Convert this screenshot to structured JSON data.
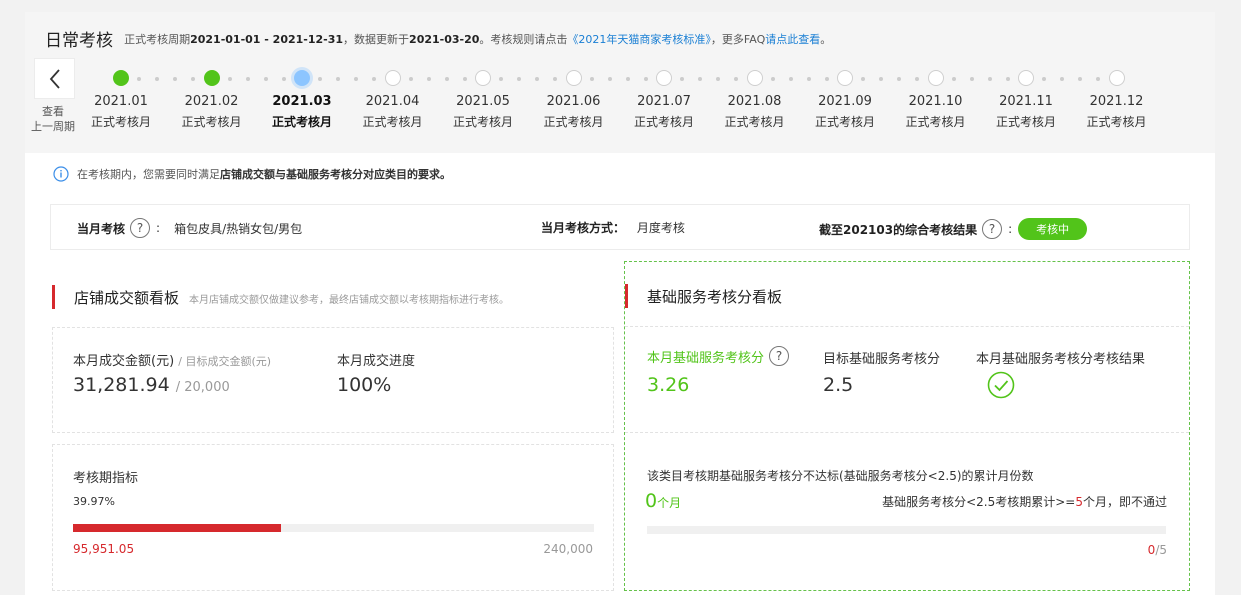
{
  "header": {
    "title": "日常考核",
    "info_pre": "正式考核周期",
    "period": "2021-01-01 - 2021-12-31",
    "info_mid1": "，数据更新于",
    "updated": "2021-03-20",
    "info_mid2": "。考核规则请点击",
    "rule_link": "《2021年天猫商家考核标准》",
    "info_mid3": "，更多FAQ",
    "faq_link": "请点此查看",
    "info_end": "。"
  },
  "back_button": {
    "label_line1": "查看",
    "label_line2": "上一周期"
  },
  "timeline": {
    "steps": [
      {
        "month": "2021.01",
        "label": "正式考核月",
        "status": "done"
      },
      {
        "month": "2021.02",
        "label": "正式考核月",
        "status": "done"
      },
      {
        "month": "2021.03",
        "label": "正式考核月",
        "status": "current"
      },
      {
        "month": "2021.04",
        "label": "正式考核月",
        "status": "todo"
      },
      {
        "month": "2021.05",
        "label": "正式考核月",
        "status": "todo"
      },
      {
        "month": "2021.06",
        "label": "正式考核月",
        "status": "todo"
      },
      {
        "month": "2021.07",
        "label": "正式考核月",
        "status": "todo"
      },
      {
        "month": "2021.08",
        "label": "正式考核月",
        "status": "todo"
      },
      {
        "month": "2021.09",
        "label": "正式考核月",
        "status": "todo"
      },
      {
        "month": "2021.10",
        "label": "正式考核月",
        "status": "todo"
      },
      {
        "month": "2021.11",
        "label": "正式考核月",
        "status": "todo"
      },
      {
        "month": "2021.12",
        "label": "正式考核月",
        "status": "todo"
      }
    ]
  },
  "notice": {
    "pre": "在考核期内，您需要同时满足",
    "bold": "店铺成交额与基础服务考核分对应类目的要求。"
  },
  "summary": {
    "month_label": "当月考核",
    "month_value": "箱包皮具/热销女包/男包",
    "method_label": "当月考核方式：",
    "method_value": "月度考核",
    "result_label": "截至202103的综合考核结果",
    "result_badge": "考核中"
  },
  "left": {
    "title": "店铺成交额看板",
    "tip": "本月店铺成交额仅做建议参考，最终店铺成交额以考核期指标进行考核。",
    "amount_label": "本月成交金额(元)",
    "target_label": "/ 目标成交金额(元)",
    "amount": "31,281.94",
    "target": "/ 20,000",
    "progress_label": "本月成交进度",
    "progress": "100%",
    "period_label": "考核期指标",
    "period_percent": "39.97%",
    "period_current": "95,951.05",
    "period_target": "240,000",
    "period_ratio": 0.3997
  },
  "right": {
    "title": "基础服务考核分看板",
    "score_label": "本月基础服务考核分",
    "score": "3.26",
    "target_label": "目标基础服务考核分",
    "target": "2.5",
    "result_label": "本月基础服务考核分考核结果",
    "fail_desc": "该类目考核期基础服务考核分不达标(基础服务考核分<2.5)的累计月份数",
    "fail_count": "0",
    "fail_unit": "个月",
    "rule_pre": "基础服务考核分<2.5考核期累计>=",
    "rule_num": "5",
    "rule_post": "个月，即不通过",
    "progress_cur": "0",
    "progress_total": "/5",
    "fail_ratio": 0
  },
  "colors": {
    "green": "#52c41a",
    "red": "#d6292d",
    "blue": "#1a7fd4",
    "current": "#8cc5ff"
  }
}
